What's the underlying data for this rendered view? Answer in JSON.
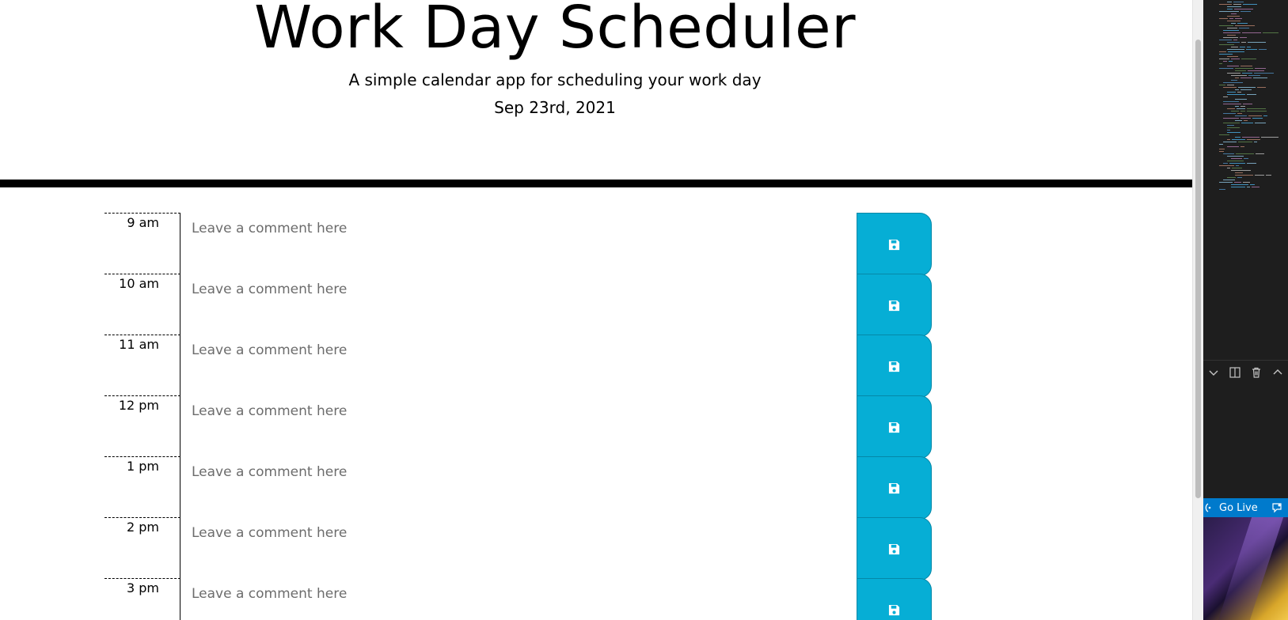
{
  "header": {
    "title": "Work Day Scheduler",
    "subtitle": "A simple calendar app for scheduling your work day",
    "current_date": "Sep 23rd, 2021"
  },
  "schedule": {
    "placeholder": "Leave a comment here",
    "accent_color": "#06aed5",
    "rows": [
      {
        "hour": "9 am"
      },
      {
        "hour": "10 am"
      },
      {
        "hour": "11 am"
      },
      {
        "hour": "12 pm"
      },
      {
        "hour": "1 pm"
      },
      {
        "hour": "2 pm"
      },
      {
        "hour": "3 pm"
      }
    ],
    "save_icon": "floppy-disk-icon"
  },
  "editor": {
    "status_bar": {
      "go_live_label": "Go Live",
      "go_live_icon": "broadcast-icon",
      "feedback_icon": "feedback-icon",
      "color": "#007acc"
    },
    "toolbar_icons": [
      "chevron-down-icon",
      "split-panel-icon",
      "trash-icon",
      "chevron-up-icon"
    ]
  }
}
